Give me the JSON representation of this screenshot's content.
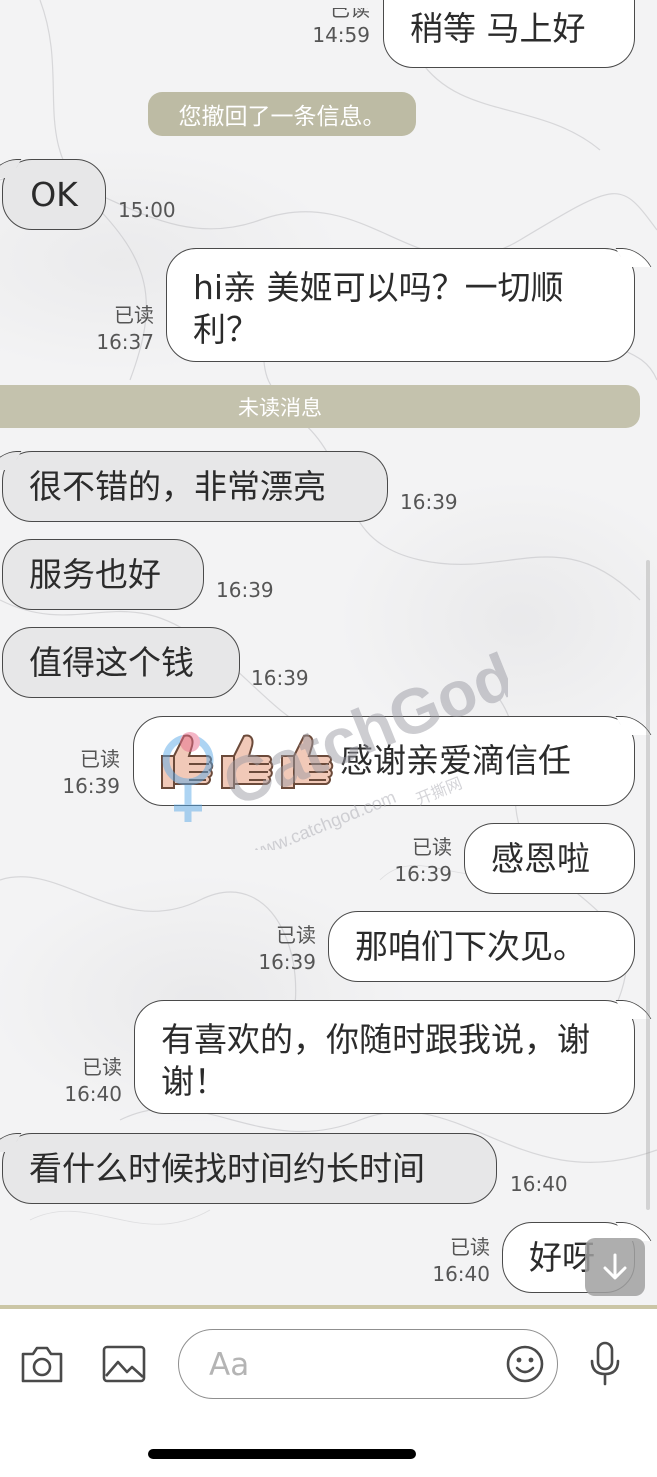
{
  "messages": [
    {
      "dir": "out",
      "text": "稍等 马上好",
      "read": "已读",
      "time": "14:59"
    },
    {
      "dir": "system",
      "text": "您撤回了一条信息。"
    },
    {
      "dir": "in",
      "text": "OK",
      "time": "15:00"
    },
    {
      "dir": "out",
      "text": "hi亲 美姬可以吗？一切顺利？",
      "read": "已读",
      "time": "16:37"
    },
    {
      "dir": "divider",
      "text": "未读消息"
    },
    {
      "dir": "in",
      "text": "很不错的，非常漂亮",
      "time": "16:39"
    },
    {
      "dir": "in",
      "text": "服务也好",
      "time": "16:39"
    },
    {
      "dir": "in",
      "text": "值得这个钱",
      "time": "16:39"
    },
    {
      "dir": "out",
      "text": "感谢亲爱滴信任",
      "emoji": "thumbs-up-icon ×3",
      "read": "已读",
      "time": "16:39"
    },
    {
      "dir": "out",
      "text": "感恩啦",
      "read": "已读",
      "time": "16:39"
    },
    {
      "dir": "out",
      "text": "那咱们下次见。",
      "read": "已读",
      "time": "16:39"
    },
    {
      "dir": "out",
      "text": "有喜欢的，你随时跟我说，谢谢！",
      "read": "已读",
      "time": "16:40"
    },
    {
      "dir": "in",
      "text": "看什么时候找时间约长时间",
      "time": "16:40"
    },
    {
      "dir": "out",
      "text": "好呀",
      "read": "已读",
      "time": "16:40"
    }
  ],
  "watermark": {
    "brand": "CatchGod",
    "url": "www.catchgod.com",
    "cn": "开撕网"
  },
  "composer": {
    "placeholder": "Aa",
    "icons": [
      "camera-icon",
      "image-icon",
      "emoji-icon",
      "microphone-icon"
    ]
  },
  "theme": {
    "accent": "#c4c2ad",
    "in_bubble": "#e7e7e8",
    "out_bubble": "#ffffff"
  }
}
